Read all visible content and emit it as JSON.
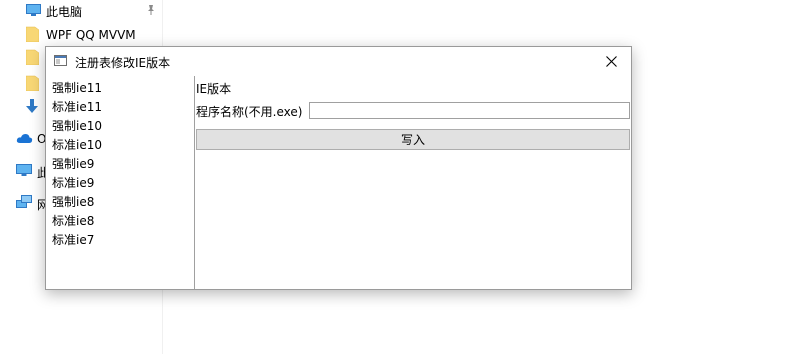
{
  "explorer_nav": {
    "items": [
      {
        "label": "此电脑",
        "icon": "computer-icon"
      },
      {
        "label": "WPF QQ MVVM",
        "icon": "folder-icon"
      },
      {
        "label": "",
        "icon": "folder-icon"
      },
      {
        "label": "",
        "icon": "folder-icon"
      },
      {
        "label": "",
        "icon": "download-arrow-icon"
      },
      {
        "label": "O",
        "icon": "onedrive-cloud-icon"
      },
      {
        "label": "此",
        "icon": "computer-icon"
      },
      {
        "label": "网",
        "icon": "network-icon"
      }
    ],
    "pin_icon": "pin-icon"
  },
  "window": {
    "title": "注册表修改IE版本",
    "close_icon": "close-icon",
    "accent": "#4a7ab5"
  },
  "list": {
    "items": [
      "强制ie11",
      "标准ie11",
      "强制ie10",
      "标准ie10",
      "强制ie9",
      "标准ie9",
      "强制ie8",
      "标准ie8",
      "标准ie7"
    ]
  },
  "form": {
    "section_label": "IE版本",
    "program_label": "程序名称(不用.exe)",
    "program_value": "",
    "write_button": "写入"
  }
}
